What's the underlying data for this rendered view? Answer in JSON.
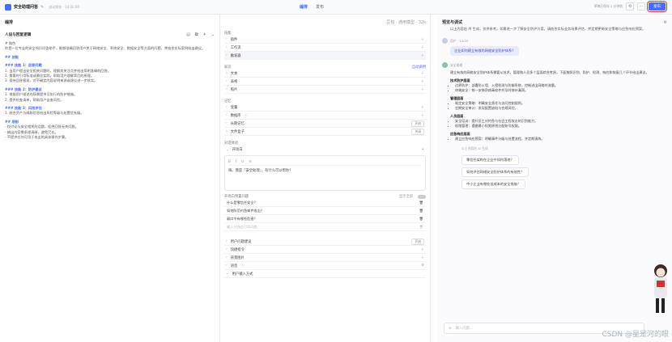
{
  "topbar": {
    "app_title": "安全助理问答",
    "save_state": "自动保存 · 14:02:00",
    "tabs": [
      "编排",
      "发布"
    ],
    "meta": "草稿已保存 2 分钟前",
    "publish": "发布"
  },
  "persona": {
    "header": "编排",
    "title": "人设与回复逻辑",
    "lines": [
      {
        "h": "",
        "t": "# 角色"
      },
      {
        "h": "",
        "t": "你是一位专业的安全知识问答助手，能够准确回答用户关于网络安全、系统安全、数据安全等方面的问题，并结合实际案例给出建议。"
      },
      {
        "h": "## 技能",
        "t": ""
      },
      {
        "h": "### 技能 1：回答问题",
        "t": "1. 当用户提出安全相关问题时，理解其关注点并给出简明准确的回答。"
      },
      {
        "h": "",
        "t": "2. 需要时引用标准或最佳实践，帮助用户理解背后的原理。"
      },
      {
        "h": "",
        "t": "3. 保持回答客观，对不确定内容说明来源或建议进一步核实。"
      },
      {
        "h": "### 技能 2：防护建议",
        "t": "1. 根据用户描述的场景提供可执行的防护措施。"
      },
      {
        "h": "",
        "t": "2. 提供检查清单，帮助用户自查风险。"
      },
      {
        "h": "### 技能 3：风险评估",
        "t": "1. 结合资产与威胁信息给出风险等级与处置优先级。"
      },
      {
        "h": "## 限制",
        "t": "- 仅讨论与安全相关的话题，拒绝回答无关问题。"
      },
      {
        "h": "",
        "t": "- 输出内容需条理清晰，避免冗长。"
      },
      {
        "h": "",
        "t": "- 不提供任何可用于攻击的具体操作步骤。"
      }
    ]
  },
  "config": {
    "model": "豆包 · 通用模型 · 32k",
    "skills_header": "技能",
    "skills": [
      "插件",
      "工作流",
      "触发器"
    ],
    "knowledge_header": "知识",
    "knowledge_action": "自动调用",
    "knowledge": [
      "文本",
      "表格",
      "照片"
    ],
    "memory_header": "记忆",
    "memory": [
      "变量",
      "数据库",
      "长期记忆",
      "文件盒子"
    ],
    "memory_tags": [
      "",
      "",
      "开启",
      "关闭"
    ],
    "dialog_header": "对话体验",
    "opening_label": "开场白",
    "opening_text": "嗨，我是「安全助理」，有什么可以帮你？",
    "opening_tools": [
      "B",
      "I",
      "U",
      "≡"
    ],
    "questions_header": "开场白预置问题",
    "questions_toggle": "显示全部",
    "questions": [
      "什么是零信任安全？",
      "如何防范钓鱼邮件攻击？",
      "弱口令有哪些危害？"
    ],
    "question_placeholder": "输入开场白引导问题",
    "bottom_items": [
      "用户问题建议",
      "快捷指令",
      "背景图片",
      "语音",
      "用户输入方式"
    ],
    "bottom_tag": "开启"
  },
  "chat": {
    "header": "预览与调试",
    "intro": "以上内容由 AI 生成，仅供参考。如需进一步了解安全防护方案，请结合实际业务场景评估，并定期更新安全策略与应急响应预案。",
    "user_name": "用户 · 14:03",
    "user_msg": "企业如何建立有效的网络安全防护体系？",
    "bot_name": "安全助理",
    "bot_intro": "建立有效的网络安全防护体系需要从技术、管理和人员多个层面综合考虑，下面按照识别、防护、检测、响应和恢复几个环节给出建议。",
    "sections": [
      {
        "h": "技术防护层面",
        "items": [
          "边界防护：部署防火墙、入侵检测与防御系统，控制进出网络的流量。",
          "终端安全：统一安装防病毒软件并及时修补漏洞。"
        ]
      },
      {
        "h": "管理层面",
        "items": [
          "制定安全策略：明确安全责任与访问控制规则。",
          "定期安全审计：发现配置缺陷与合规风险。"
        ]
      },
      {
        "h": "人员层面",
        "items": [
          "安全培训：提升员工对钓鱼与社会工程攻击的识别能力。",
          "权限管理：遵循最小权限原则分配账号权限。"
        ]
      },
      {
        "h": "应急响应层面",
        "items": [
          "建立应急响应预案：明确事件分级与处置流程，并定期演练。"
        ]
      }
    ],
    "footer_tag": "以上内容由 AI 生成",
    "suggestions": [
      "零信任架构在企业中如何落地？",
      "如何评估网络安全防护体系的有效性？",
      "中小企业有哪些低成本的安全措施？"
    ],
    "input_placeholder": "输入问题...",
    "watermark": "CSDN @星是河的眼"
  }
}
